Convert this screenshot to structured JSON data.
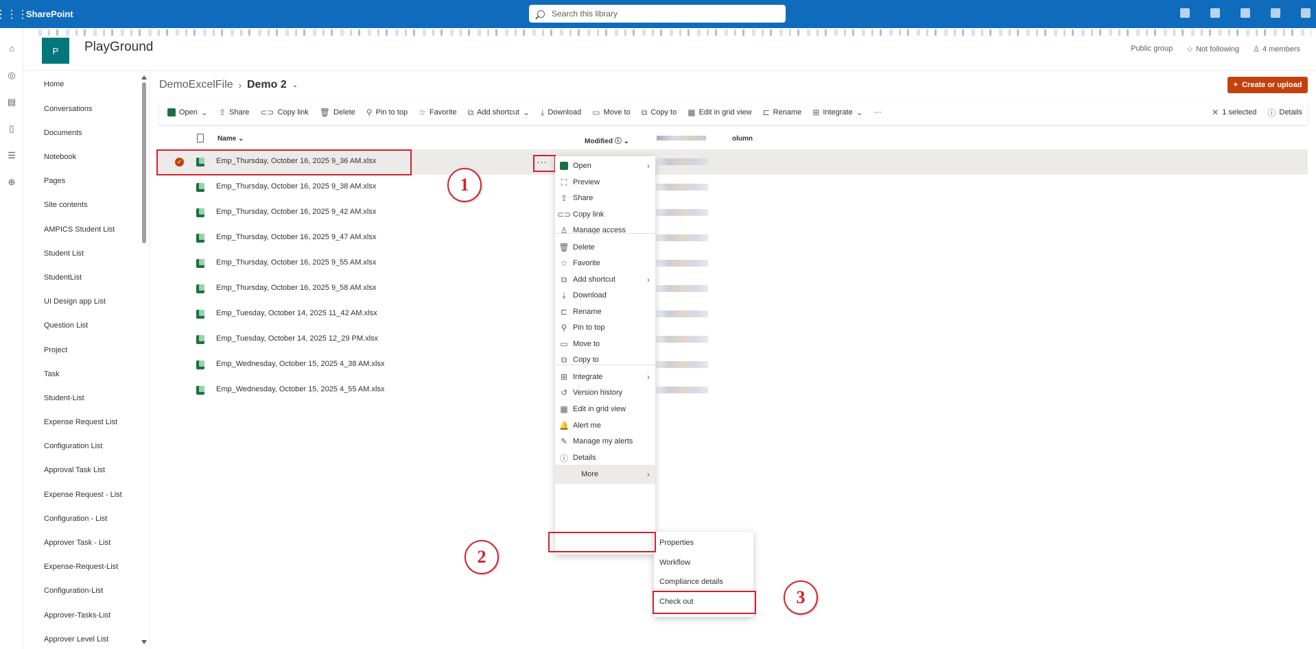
{
  "suitebar": {
    "app_name": "SharePoint",
    "search_placeholder": "Search this library"
  },
  "site": {
    "logo_letter": "P",
    "title": "PlayGround",
    "visibility": "Public group",
    "follow": "Not following",
    "members": "4 members"
  },
  "nav": {
    "items": [
      "Home",
      "Conversations",
      "Documents",
      "Notebook",
      "Pages",
      "Site contents",
      "AMPICS Student List",
      "Student List",
      "StudentList",
      "UI Design app List",
      "Question List",
      "Project",
      "Task",
      "Student-List",
      "Expense Request List",
      "Configuration List",
      "Approval Task List",
      "Expense Request - List",
      "Configuration - List",
      "Approver Task - List",
      "Expense-Request-List",
      "Configuration-List",
      "Approver-Tasks-List",
      "Approver Level List"
    ]
  },
  "breadcrumb": {
    "parent": "DemoExcelFile",
    "current": "Demo 2"
  },
  "create_button": "Create or upload",
  "commands": {
    "open": "Open",
    "share": "Share",
    "copy_link": "Copy link",
    "delete": "Delete",
    "pin_to_top": "Pin to top",
    "favorite": "Favorite",
    "add_shortcut": "Add shortcut",
    "download": "Download",
    "move_to": "Move to",
    "copy_to": "Copy to",
    "edit_grid": "Edit in grid view",
    "rename": "Rename",
    "integrate": "Integrate",
    "more": "···",
    "selected": "1 selected",
    "details": "Details"
  },
  "columns": {
    "name": "Name",
    "modified": "Modified",
    "column": "olumn"
  },
  "files": [
    "Emp_Thursday, October 16, 2025 9_36 AM.xlsx",
    "Emp_Thursday, October 16, 2025 9_38 AM.xlsx",
    "Emp_Thursday, October 16, 2025 9_42 AM.xlsx",
    "Emp_Thursday, October 16, 2025 9_47 AM.xlsx",
    "Emp_Thursday, October 16, 2025 9_55 AM.xlsx",
    "Emp_Thursday, October 16, 2025 9_58 AM.xlsx",
    "Emp_Tuesday, October 14, 2025 11_42 AM.xlsx",
    "Emp_Tuesday, October 14, 2025 12_29 PM.xlsx",
    "Emp_Wednesday, October 15, 2025 4_38 AM.xlsx",
    "Emp_Wednesday, October 15, 2025 4_55 AM.xlsx"
  ],
  "context_menu": [
    {
      "label": "Open",
      "icon": "excel-icon"
    },
    {
      "label": "Preview",
      "icon": "preview-icon"
    },
    {
      "label": "Share",
      "icon": "share-icon"
    },
    {
      "label": "Copy link",
      "icon": "link-icon"
    },
    {
      "label": "Manage access",
      "icon": "person-icon"
    },
    {
      "label": "Delete",
      "icon": "trash-icon"
    },
    {
      "label": "Favorite",
      "icon": "star-icon"
    },
    {
      "label": "Add shortcut",
      "icon": "shortcut-icon"
    },
    {
      "label": "Download",
      "icon": "download-icon"
    },
    {
      "label": "Rename",
      "icon": "rename-icon"
    },
    {
      "label": "Pin to top",
      "icon": "pin-icon"
    },
    {
      "label": "Move to",
      "icon": "move-icon"
    },
    {
      "label": "Copy to",
      "icon": "copy-icon"
    },
    {
      "label": "Integrate",
      "icon": "integrate-icon"
    },
    {
      "label": "Version history",
      "icon": "history-icon"
    },
    {
      "label": "Edit in grid view",
      "icon": "grid-icon"
    },
    {
      "label": "Alert me",
      "icon": "bell-icon"
    },
    {
      "label": "Manage my alerts",
      "icon": "alerts-icon"
    },
    {
      "label": "Details",
      "icon": "info-icon"
    },
    {
      "label": "More",
      "icon": ""
    }
  ],
  "more_submenu": [
    "Properties",
    "Workflow",
    "Compliance details",
    "Check out"
  ],
  "annotations": [
    "1",
    "2",
    "3"
  ],
  "colors": {
    "suitebar": "#0f6cbd",
    "accent": "#c4410c",
    "highlight": "#d1222b",
    "site_logo": "#03787c"
  }
}
